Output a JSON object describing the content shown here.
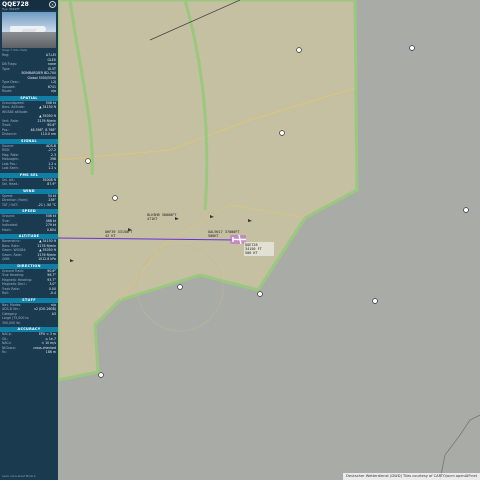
{
  "panel": {
    "callsign": "QQE728",
    "hex_line": "Hex: 8661EF",
    "photo_credit": "Image © Wilco Pieter",
    "details": [
      {
        "k": "Reg:",
        "v": "A7-LEI"
      },
      {
        "k": "",
        "v": "GLEX"
      },
      {
        "k": "DB Flags:",
        "v": "none"
      },
      {
        "k": "Type:",
        "v": "GL5T"
      },
      {
        "k": "",
        "v": "BOMBARDIER BD-700"
      },
      {
        "k": "",
        "v": "Global 5000/5500"
      },
      {
        "k": "Type Desc.:",
        "v": "L2J"
      },
      {
        "k": "Squawk:",
        "v": "6741"
      },
      {
        "k": "Route:",
        "v": "n/a"
      }
    ],
    "sections": [
      {
        "title": "SPATIAL",
        "rows": [
          {
            "k": "Groundspeed:",
            "v": "506 kt"
          },
          {
            "k": "Baro. Altitude:",
            "v": "▲ 34150 ft"
          },
          {
            "k": "WGS84 altitude:",
            "v": ""
          },
          {
            "k": "",
            "v": "▲ 35050 ft"
          },
          {
            "k": "Vert. Rate:",
            "v": "2176 ft/min"
          },
          {
            "k": "Track:",
            "v": "90.6°"
          },
          {
            "k": "Pos.:",
            "v": "48.598°, 8.768°"
          },
          {
            "k": "Distance:",
            "v": "110.0 nm"
          }
        ]
      },
      {
        "title": "SIGNAL",
        "rows": [
          {
            "k": "Source:",
            "v": "ADS-B"
          },
          {
            "k": "RSSI:",
            "v": "-27.2"
          },
          {
            "k": "Msg. Rate:",
            "v": "2.3"
          },
          {
            "k": "Messages:",
            "v": "398"
          },
          {
            "k": "Last Pos.:",
            "v": "1.2 s"
          },
          {
            "k": "Last Seen:",
            "v": "1.2 s"
          }
        ]
      },
      {
        "title": "FMS SEL",
        "rows": [
          {
            "k": "Sel. Alt.:",
            "v": "35008 ft"
          },
          {
            "k": "Sel. Head.:",
            "v": "87.9°"
          }
        ]
      },
      {
        "title": "WIND",
        "rows": [
          {
            "k": "Speed:",
            "v": "54 kt"
          },
          {
            "k": "Direction (from):",
            "v": "238°"
          },
          {
            "k": "TAT / OAT:",
            "v": "-21 / -50 °C"
          }
        ]
      },
      {
        "title": "SPEED",
        "rows": [
          {
            "k": "Ground:",
            "v": "506 kt"
          },
          {
            "k": "True:",
            "v": "468 kt"
          },
          {
            "k": "Indicated:",
            "v": "279 kt"
          },
          {
            "k": "Mach:",
            "v": "0.804"
          }
        ]
      },
      {
        "title": "ALTITUDE",
        "rows": [
          {
            "k": "Barometric:",
            "v": "▲ 34150 ft"
          },
          {
            "k": "Baro. Rate:",
            "v": "2176 ft/min"
          },
          {
            "k": "Geom. WGS84:",
            "v": "▲ 35050 ft"
          },
          {
            "k": "Geom. Rate:",
            "v": "2176 ft/min"
          },
          {
            "k": "QNH:",
            "v": "1012.8 hPa"
          }
        ]
      },
      {
        "title": "DIRECTION",
        "rows": [
          {
            "k": "Ground Track:",
            "v": "90.6°"
          },
          {
            "k": "True Heading:",
            "v": "96.7°"
          },
          {
            "k": "Magnetic Heading:",
            "v": "93.7°"
          },
          {
            "k": "Magnetic Decl.:",
            "v": "3.0°"
          },
          {
            "k": "Track Rate:",
            "v": "0.00"
          },
          {
            "k": "Roll:",
            "v": "-0.4"
          }
        ]
      },
      {
        "title": "STUFF",
        "rows": [
          {
            "k": "Nav. Modes:",
            "v": "n/a"
          },
          {
            "k": "ADS-B Ver.:",
            "v": "v2 (DO-260B)"
          },
          {
            "k": "Category:",
            "v": "A3"
          },
          {
            "k": "Large (75,000 to",
            "v": ""
          },
          {
            "k": "300,000 lb)",
            "v": ""
          }
        ]
      },
      {
        "title": "ACCURACY",
        "rows": [
          {
            "k": "NACp:",
            "v": "EPU < 3 m"
          },
          {
            "k": "SIL:",
            "v": "≤ 1e-7"
          },
          {
            "k": "NACv:",
            "v": "< 10 m/s"
          },
          {
            "k": "NICbaro:",
            "v": "cross-checked"
          },
          {
            "k": "Rc:",
            "v": "186 m"
          }
        ]
      }
    ],
    "footer": "Learn more about Mode S"
  },
  "map": {
    "aircraft_label_lines": [
      "QQE728",
      "34150 FT",
      "506 KT"
    ],
    "other_labels": [
      [
        "DLH3HB 38000FT",
        "471KT"
      ],
      [
        "OHF39 33150FT",
        "42 KT"
      ],
      [
        "UAL9017 37000FT",
        "506KT"
      ]
    ],
    "colors": {
      "map_bg": "#a9aca6",
      "airspace_fill": "#c9c3a0",
      "airspace_border": "#9bc87f",
      "track": "#6a30d6",
      "aircraft": "#c060d8"
    }
  },
  "attribution": "Deutscher Wetterdienst (DWD) Tiles courtesy of CARTO/ocm openAIP.net"
}
